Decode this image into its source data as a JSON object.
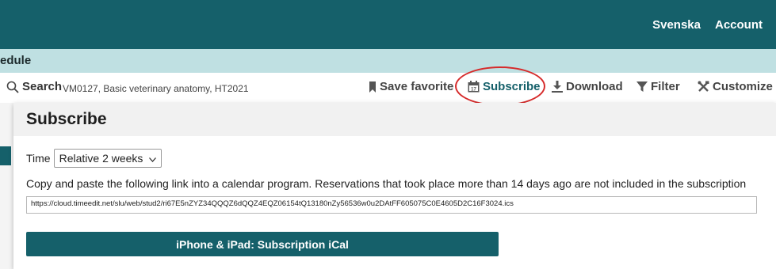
{
  "topnav": {
    "lang": "Svenska",
    "account": "Account"
  },
  "breadcrumb": {
    "text": "edule"
  },
  "toolbar": {
    "search_label": "Search",
    "search_context": "VM0127, Basic veterinary anatomy, HT2021",
    "save_favorite": "Save favorite",
    "subscribe": "Subscribe",
    "download": "Download",
    "filter": "Filter",
    "customize": "Customize"
  },
  "panel": {
    "title": "Subscribe",
    "time_label": "Time",
    "time_value": "Relative 2 weeks",
    "description": "Copy and paste the following link into a calendar program. Reservations that took place more than 14 days ago are not included in the subscription",
    "url": "https://cloud.timeedit.net/slu/web/stud2/ri67E5nZYZ34QQQZ6dQQZ4EQZ06154tQ13180nZy56536w0u2DAtFF605075C0E4605D2C16F3024.ics",
    "ical_button": "iPhone & iPad: Subscription iCal"
  },
  "colors": {
    "brand": "#15606a",
    "subbar": "#bfe0e2",
    "highlight": "#d62b2b"
  }
}
